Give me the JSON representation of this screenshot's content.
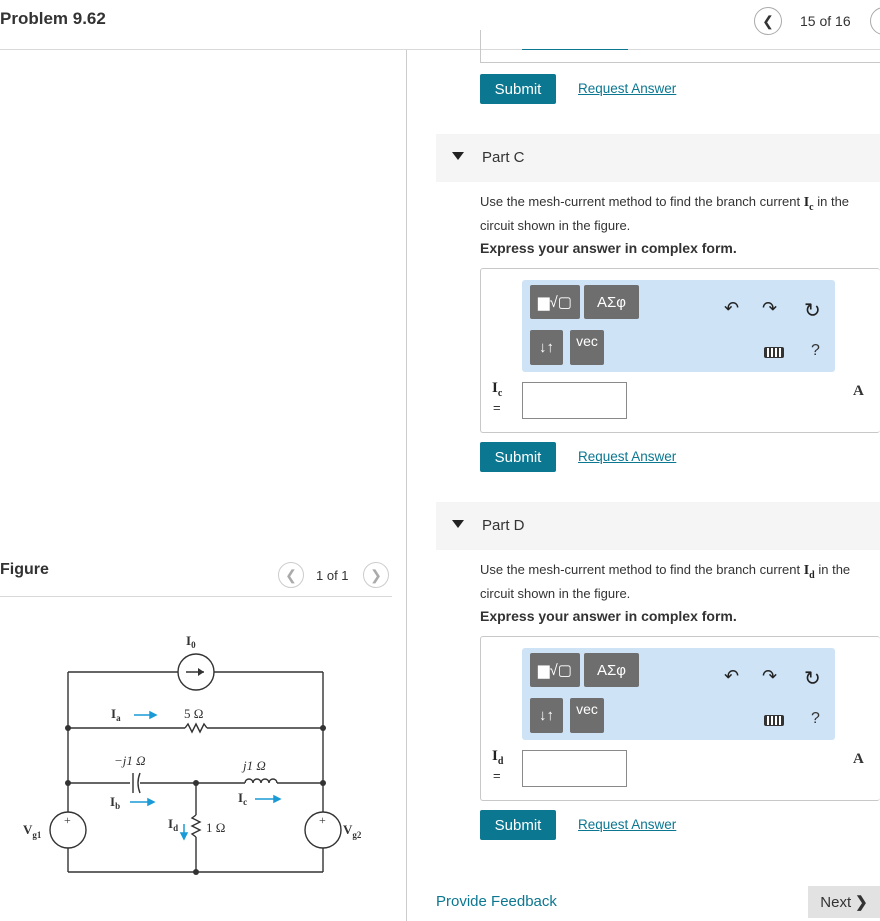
{
  "header": {
    "title": "Problem 9.62",
    "prev_icon": "chevron-left-icon",
    "counter": "15 of 16"
  },
  "figure_panel": {
    "label": "Figure",
    "counter": "1 of 1",
    "circuit": {
      "I0": "I",
      "I0_sub": "0",
      "Ia": "I",
      "Ia_sub": "a",
      "Ib": "I",
      "Ib_sub": "b",
      "Ic": "I",
      "Ic_sub": "c",
      "Id": "I",
      "Id_sub": "d",
      "r5": "5 Ω",
      "cap": "−j1 Ω",
      "ind": "j1 Ω",
      "r1": "1 Ω",
      "vg1": "V",
      "vg1_sub": "g1",
      "vg2": "V",
      "vg2_sub": "g2",
      "plus": "+"
    }
  },
  "top_partial": {
    "submit": "Submit",
    "request": "Request Answer"
  },
  "part_c": {
    "label": "Part C",
    "question_pre": "Use the mesh-current method to find the branch current ",
    "var": "I",
    "var_sub": "c",
    "question_post": " in the circuit shown in the figure.",
    "express": "Express your answer in complex form.",
    "toolbar": {
      "templates": "▆√▢",
      "greek": "ΑΣφ",
      "arrows": "↓↑",
      "vec": "vec",
      "help": "?"
    },
    "answer_label": "I",
    "answer_sub": "c",
    "equals": "=",
    "input_value": "",
    "unit": "A",
    "submit": "Submit",
    "request": "Request Answer"
  },
  "part_d": {
    "label": "Part D",
    "question_pre": "Use the mesh-current method to find the branch current ",
    "var": "I",
    "var_sub": "d",
    "question_post": " in the circuit shown in the figure.",
    "express": "Express your answer in complex form.",
    "toolbar": {
      "templates": "▆√▢",
      "greek": "ΑΣφ",
      "arrows": "↓↑",
      "vec": "vec",
      "help": "?"
    },
    "answer_label": "I",
    "answer_sub": "d",
    "equals": "=",
    "input_value": "",
    "unit": "A",
    "submit": "Submit",
    "request": "Request Answer"
  },
  "footer": {
    "feedback": "Provide Feedback",
    "next": "Next",
    "next_icon": "chevron-right-icon"
  },
  "colors": {
    "accent": "#0b7790",
    "toolbar_bg": "#cfe3f6",
    "circuit_blue": "#1a9ad6"
  }
}
